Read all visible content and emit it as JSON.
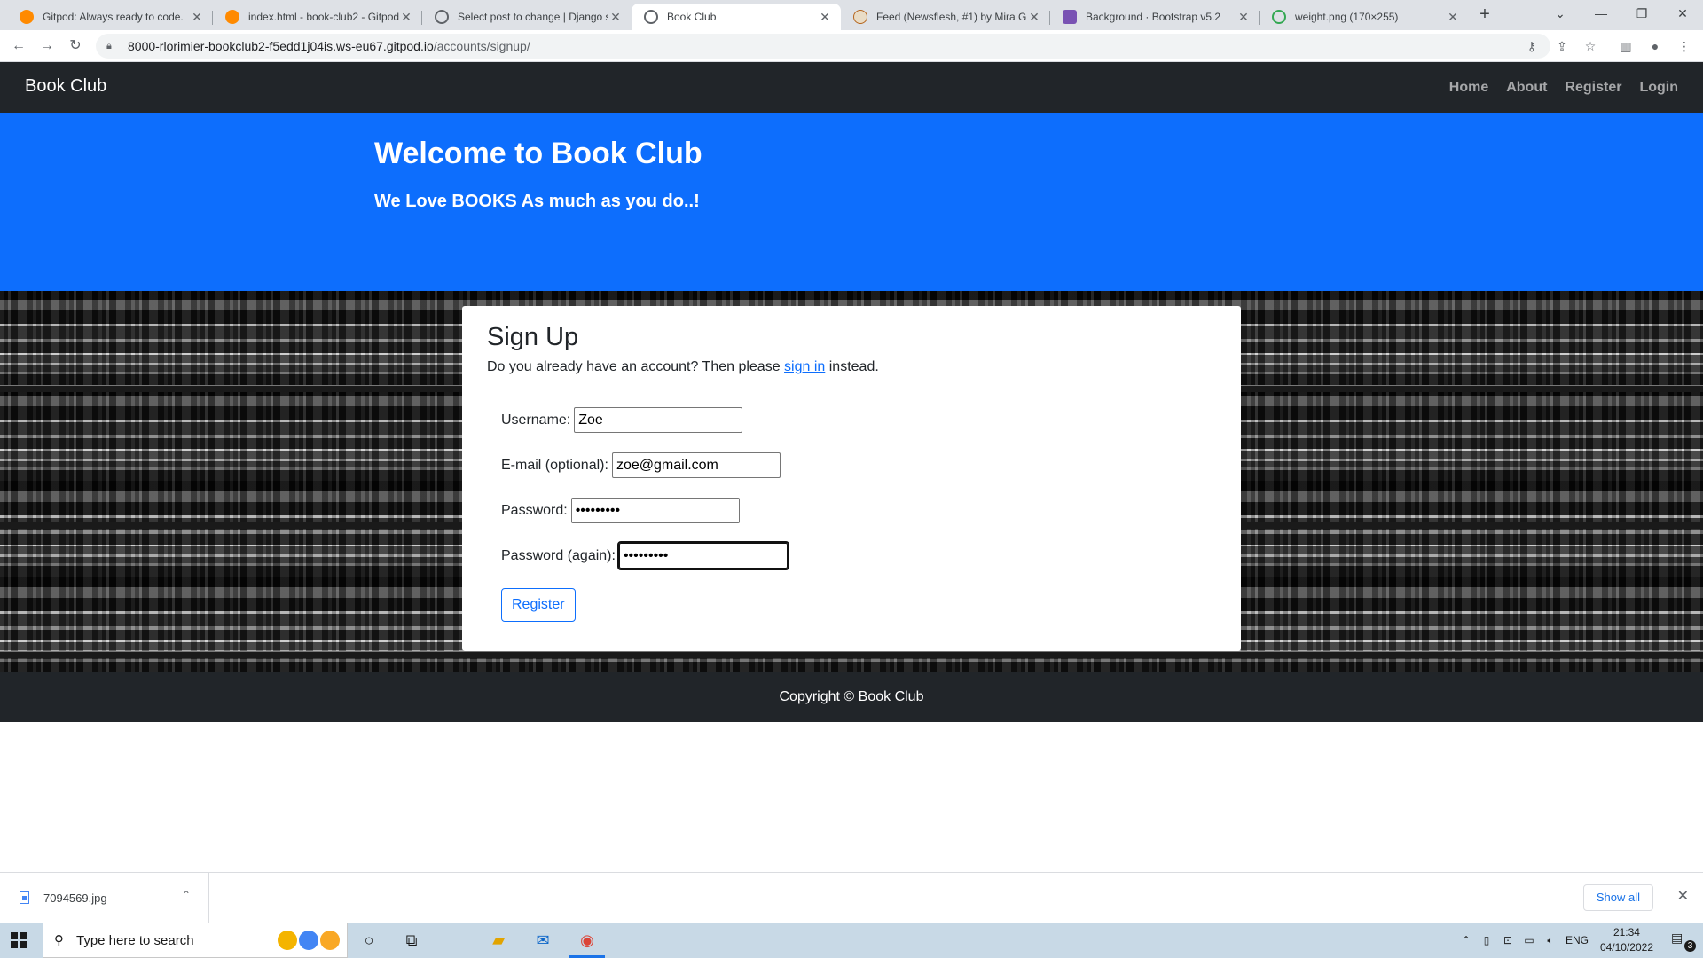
{
  "browser": {
    "tabs": [
      {
        "title": "Gitpod: Always ready to code.",
        "favicon_color": "#ff8a00",
        "icon": "gitpod-icon"
      },
      {
        "title": "index.html - book-club2 - Gitpod",
        "favicon_color": "#ff8a00",
        "icon": "gitpod-icon"
      },
      {
        "title": "Select post to change | Django site admin",
        "favicon_color": "#5f6368",
        "icon": "globe-icon"
      },
      {
        "title": "Book Club",
        "favicon_color": "#5f6368",
        "icon": "globe-icon",
        "active": true
      },
      {
        "title": "Feed (Newsflesh, #1) by Mira Grant",
        "favicon_color": "#b5651d",
        "icon": "goodreads-icon"
      },
      {
        "title": "Background · Bootstrap v5.2",
        "favicon_color": "#7952b3",
        "icon": "bootstrap-icon"
      },
      {
        "title": "weight.png (170×255)",
        "favicon_color": "#34a853",
        "icon": "image-check-icon"
      }
    ],
    "url_host": "8000-rlorimier-bookclub2-f5edd1j04is.ws-eu67.gitpod.io",
    "url_path": "/accounts/signup/"
  },
  "page": {
    "brand": "Book Club",
    "nav": {
      "home": "Home",
      "about": "About",
      "register": "Register",
      "login": "Login"
    },
    "hero": {
      "title": "Welcome to Book Club",
      "subtitle": "We Love BOOKS As much as you do..!"
    },
    "signup": {
      "heading": "Sign Up",
      "intro_before": "Do you already have an account? Then please ",
      "intro_link": "sign in",
      "intro_after": " instead.",
      "fields": {
        "username_label": "Username:",
        "username_value": "Zoe",
        "email_label": "E-mail (optional):",
        "email_value": "zoe@gmail.com",
        "password_label": "Password:",
        "password_value": "•••••••••",
        "password2_label": "Password (again):",
        "password2_value": "•••••••••"
      },
      "submit": "Register"
    },
    "footer": "Copyright © Book Club"
  },
  "downloads": {
    "file": "7094569.jpg",
    "show_all": "Show all"
  },
  "taskbar": {
    "search_placeholder": "Type here to search",
    "language": "ENG",
    "time": "21:34",
    "date": "04/10/2022",
    "notifications": "3"
  }
}
